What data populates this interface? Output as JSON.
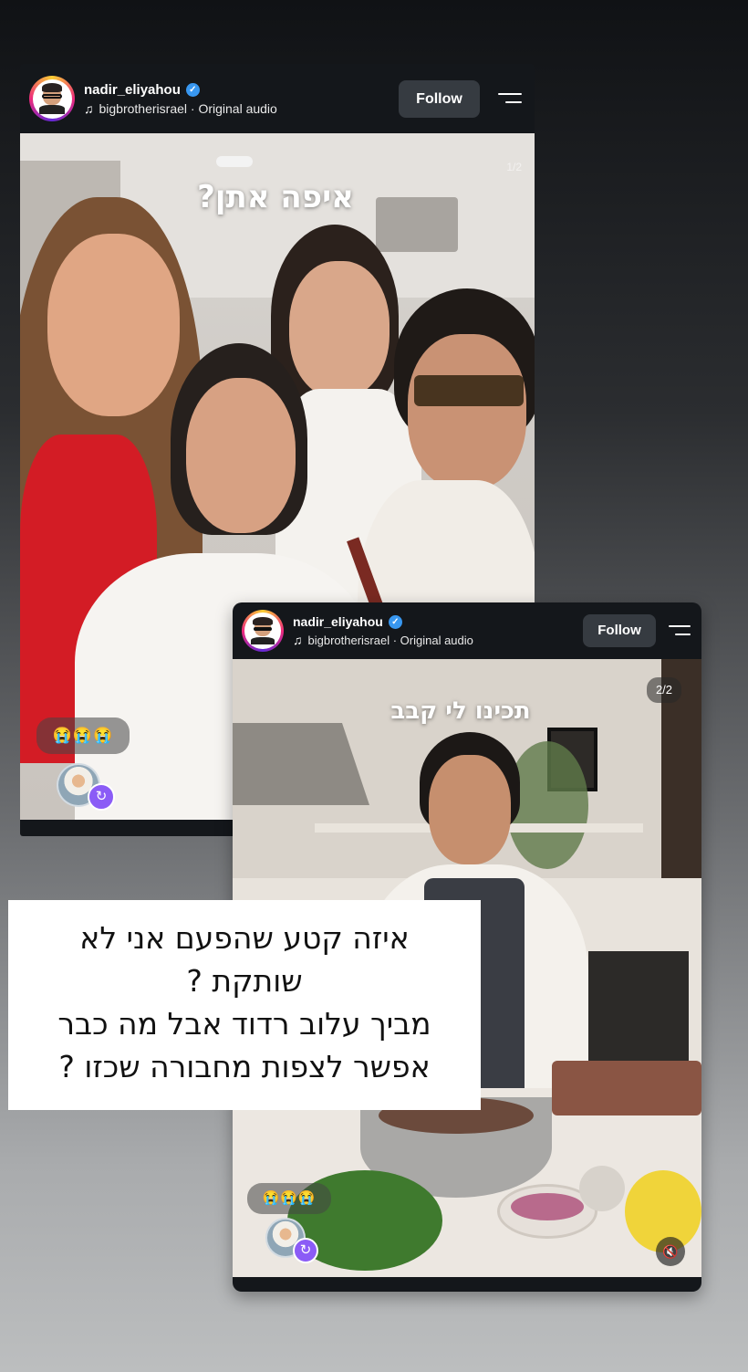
{
  "reel1": {
    "username": "nadir_eliyahou",
    "verified_icon": "verified-badge-icon",
    "audio": "bigbrotherisrael · Original audio",
    "follow_label": "Follow",
    "overlay_text": "איפה אתן?",
    "page_indicator": "1/2",
    "reaction_emojis": "😭😭😭"
  },
  "reel2": {
    "username": "nadir_eliyahou",
    "verified_icon": "verified-badge-icon",
    "audio": "bigbrotherisrael · Original audio",
    "follow_label": "Follow",
    "overlay_text": "תכינו לי קבב",
    "page_indicator": "2/2",
    "reaction_emojis": "😭😭😭"
  },
  "caption": {
    "lines": [
      "איזה קטע שהפעם אני לא",
      "שותקת ?",
      "מביך עלוב רדוד אבל מה כבר",
      "אפשר לצפות מחבורה שכזו ?"
    ]
  },
  "colors": {
    "card_bg": "#14171b",
    "follow_bg": "#363b41",
    "verified": "#3897f0",
    "remix": "#8b5cf6"
  }
}
